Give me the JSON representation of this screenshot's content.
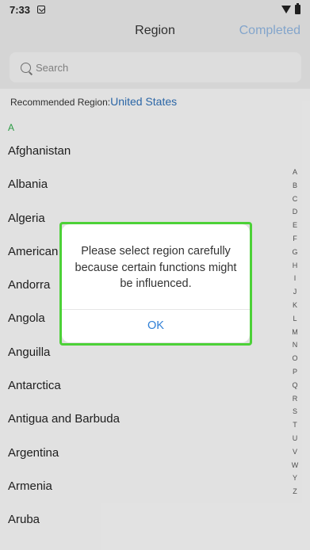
{
  "status_bar": {
    "time": "7:33"
  },
  "header": {
    "title": "Region",
    "action": "Completed"
  },
  "search": {
    "placeholder": "Search"
  },
  "recommended": {
    "label": "Recommended Region:",
    "value": "United States"
  },
  "section": {
    "letter": "A"
  },
  "countries": [
    "Afghanistan",
    "Albania",
    "Algeria",
    "American",
    "Andorra",
    "Angola",
    "Anguilla",
    "Antarctica",
    "Antigua and Barbuda",
    "Argentina",
    "Armenia",
    "Aruba"
  ],
  "index_letters": [
    "A",
    "B",
    "C",
    "D",
    "E",
    "F",
    "G",
    "H",
    "I",
    "J",
    "K",
    "L",
    "M",
    "N",
    "O",
    "P",
    "Q",
    "R",
    "S",
    "T",
    "U",
    "V",
    "W",
    "Y",
    "Z"
  ],
  "dialog": {
    "message": "Please select region carefully because certain functions might be influenced.",
    "ok_label": "OK"
  },
  "colors": {
    "accent": "#2f7fd6",
    "highlight_frame": "#4cd137",
    "section_letter": "#2faa4a"
  }
}
